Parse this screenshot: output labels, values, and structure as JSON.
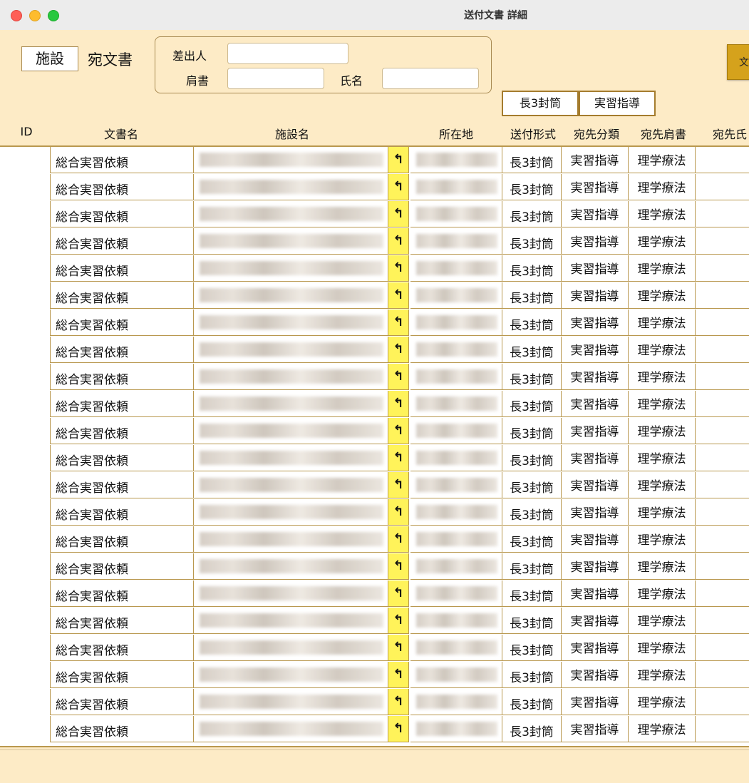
{
  "window": {
    "title": "送付文書 詳細"
  },
  "header": {
    "facility_label": "施設",
    "doc_title": "宛文書",
    "sender_label": "差出人",
    "sender_value": "",
    "position_label": "肩書",
    "position_value": "",
    "name_label": "氏名",
    "name_value": "",
    "side_button": "文"
  },
  "tags": {
    "envelope": "長3封筒",
    "category": "実習指導"
  },
  "columns": [
    "ID",
    "文書名",
    "施設名",
    "所在地",
    "送付形式",
    "宛先分類",
    "宛先肩書",
    "宛先氏"
  ],
  "rows": [
    {
      "name": "総合実習依頼",
      "send": "長3封筒",
      "cat": "実習指導",
      "title": "理学療法"
    },
    {
      "name": "総合実習依頼",
      "send": "長3封筒",
      "cat": "実習指導",
      "title": "理学療法"
    },
    {
      "name": "総合実習依頼",
      "send": "長3封筒",
      "cat": "実習指導",
      "title": "理学療法"
    },
    {
      "name": "総合実習依頼",
      "send": "長3封筒",
      "cat": "実習指導",
      "title": "理学療法"
    },
    {
      "name": "総合実習依頼",
      "send": "長3封筒",
      "cat": "実習指導",
      "title": "理学療法"
    },
    {
      "name": "総合実習依頼",
      "send": "長3封筒",
      "cat": "実習指導",
      "title": "理学療法"
    },
    {
      "name": "総合実習依頼",
      "send": "長3封筒",
      "cat": "実習指導",
      "title": "理学療法"
    },
    {
      "name": "総合実習依頼",
      "send": "長3封筒",
      "cat": "実習指導",
      "title": "理学療法"
    },
    {
      "name": "総合実習依頼",
      "send": "長3封筒",
      "cat": "実習指導",
      "title": "理学療法"
    },
    {
      "name": "総合実習依頼",
      "send": "長3封筒",
      "cat": "実習指導",
      "title": "理学療法"
    },
    {
      "name": "総合実習依頼",
      "send": "長3封筒",
      "cat": "実習指導",
      "title": "理学療法"
    },
    {
      "name": "総合実習依頼",
      "send": "長3封筒",
      "cat": "実習指導",
      "title": "理学療法"
    },
    {
      "name": "総合実習依頼",
      "send": "長3封筒",
      "cat": "実習指導",
      "title": "理学療法"
    },
    {
      "name": "総合実習依頼",
      "send": "長3封筒",
      "cat": "実習指導",
      "title": "理学療法"
    },
    {
      "name": "総合実習依頼",
      "send": "長3封筒",
      "cat": "実習指導",
      "title": "理学療法"
    },
    {
      "name": "総合実習依頼",
      "send": "長3封筒",
      "cat": "実習指導",
      "title": "理学療法"
    },
    {
      "name": "総合実習依頼",
      "send": "長3封筒",
      "cat": "実習指導",
      "title": "理学療法"
    },
    {
      "name": "総合実習依頼",
      "send": "長3封筒",
      "cat": "実習指導",
      "title": "理学療法"
    },
    {
      "name": "総合実習依頼",
      "send": "長3封筒",
      "cat": "実習指導",
      "title": "理学療法"
    },
    {
      "name": "総合実習依頼",
      "send": "長3封筒",
      "cat": "実習指導",
      "title": "理学療法"
    },
    {
      "name": "総合実習依頼",
      "send": "長3封筒",
      "cat": "実習指導",
      "title": "理学療法"
    },
    {
      "name": "総合実習依頼",
      "send": "長3封筒",
      "cat": "実習指導",
      "title": "理学療法"
    }
  ],
  "icons": {
    "jump": "arrow-up-left-icon",
    "jump_glyph": "↰"
  },
  "colors": {
    "background": "#fdebc6",
    "border": "#b9984f",
    "jump_button": "#fff35a",
    "accent_button": "#d5a21c"
  }
}
